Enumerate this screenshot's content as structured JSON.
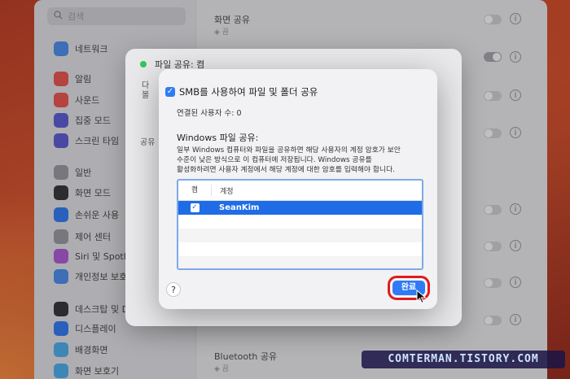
{
  "sidebar": {
    "search_placeholder": "검색",
    "items": [
      {
        "label": "네트워크",
        "color": "#4a8ef0"
      },
      {
        "label": "알림",
        "color": "#f0524a"
      },
      {
        "label": "사운드",
        "color": "#f0524a"
      },
      {
        "label": "집중 모드",
        "color": "#5b5bd6"
      },
      {
        "label": "스크린 타임",
        "color": "#5b5bd6"
      },
      {
        "label": "일반",
        "color": "#9a9aa0"
      },
      {
        "label": "화면 모드",
        "color": "#333333"
      },
      {
        "label": "손쉬운 사용",
        "color": "#2f7bf5"
      },
      {
        "label": "제어 센터",
        "color": "#9a9aa0"
      },
      {
        "label": "Siri 및 Spotlig",
        "color": "#b05ad6"
      },
      {
        "label": "개인정보 보호",
        "color": "#4a8ef0"
      },
      {
        "label": "데스크탑 및 Do",
        "color": "#333333"
      },
      {
        "label": "디스플레이",
        "color": "#2f7bf5"
      },
      {
        "label": "배경화면",
        "color": "#4ab0f0"
      },
      {
        "label": "화면 보호기",
        "color": "#4ab0f0"
      }
    ]
  },
  "main": {
    "top_row": {
      "title": "화면 공유",
      "status": "끔"
    },
    "bottom_row": {
      "title": "Bluetooth 공유",
      "status": "끔"
    }
  },
  "parent_sheet": {
    "title": "파일 공유: 켬",
    "frag1": "다",
    "frag2": "볼",
    "frag3": "공유"
  },
  "dialog": {
    "smb_label": "SMB를 사용하여 파일 및 폴더 공유",
    "connected_users": "연결된 사용자 수: 0",
    "windows_title": "Windows 파일 공유:",
    "description_lines": [
      "일부 Windows 컴퓨터와 파일을 공유하면 해당 사용자의 계정 암호가 보안",
      "수준이 낮은 방식으로 이 컴퓨터에 저장됩니다. Windows 공유를",
      "활성화하려면 사용자 계정에서 해당 계정에 대한 암호를 입력해야 합니다."
    ],
    "table": {
      "col_on": "켬",
      "col_account": "계정",
      "rows": [
        {
          "on": true,
          "account": "SeanKim"
        }
      ]
    },
    "help_label": "?",
    "done_label": "완료"
  },
  "watermark": "COMTERMAN.TISTORY.COM"
}
